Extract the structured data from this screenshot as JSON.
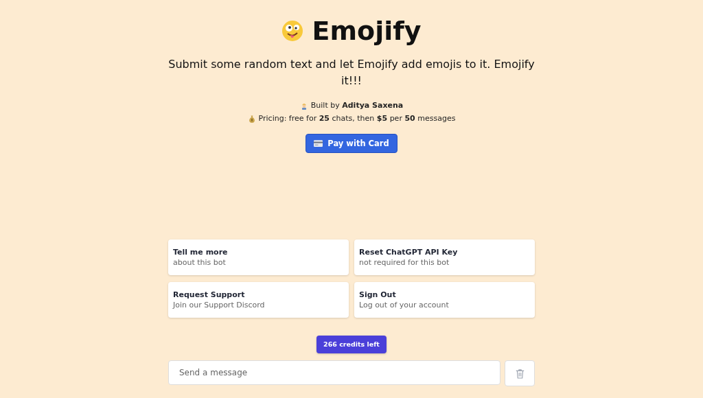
{
  "header": {
    "title": "Emojify",
    "subtitle": "Submit some random text and let Emojify add emojis to it. Emojify it!!!"
  },
  "info": [
    "Built by **Aditya Saxena**",
    "Pricing: free for **25** chats, then **$5** per **50** messages"
  ],
  "pay_button": "Pay with Card",
  "suggestions": [
    {
      "title": "Tell me more",
      "subtitle": "about this bot"
    },
    {
      "title": "Reset ChatGPT API Key",
      "subtitle": "not required for this bot"
    },
    {
      "title": "Request Support",
      "subtitle": "Join our Support Discord"
    },
    {
      "title": "Sign Out",
      "subtitle": "Log out of your account"
    }
  ],
  "credits_badge": "266 credits left",
  "message": {
    "placeholder": "Send a message"
  }
}
